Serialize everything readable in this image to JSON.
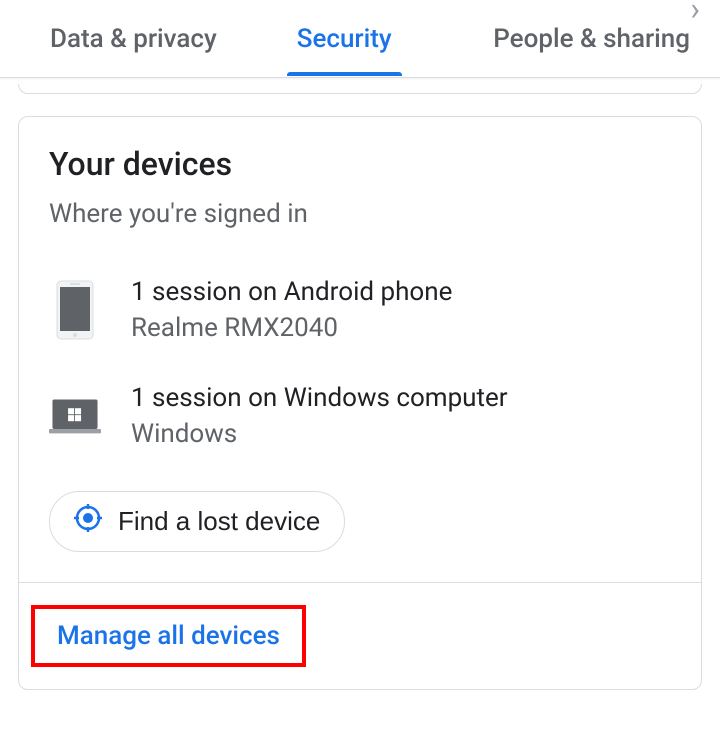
{
  "tabs": {
    "data_privacy": "Data & privacy",
    "security": "Security",
    "people_sharing": "People & sharing"
  },
  "card": {
    "title": "Your devices",
    "subtitle": "Where you're signed in",
    "devices": [
      {
        "title": "1 session on Android phone",
        "subtitle": "Realme RMX2040"
      },
      {
        "title": "1 session on Windows computer",
        "subtitle": "Windows"
      }
    ],
    "find_device": "Find a lost device",
    "manage_all": "Manage all devices"
  }
}
